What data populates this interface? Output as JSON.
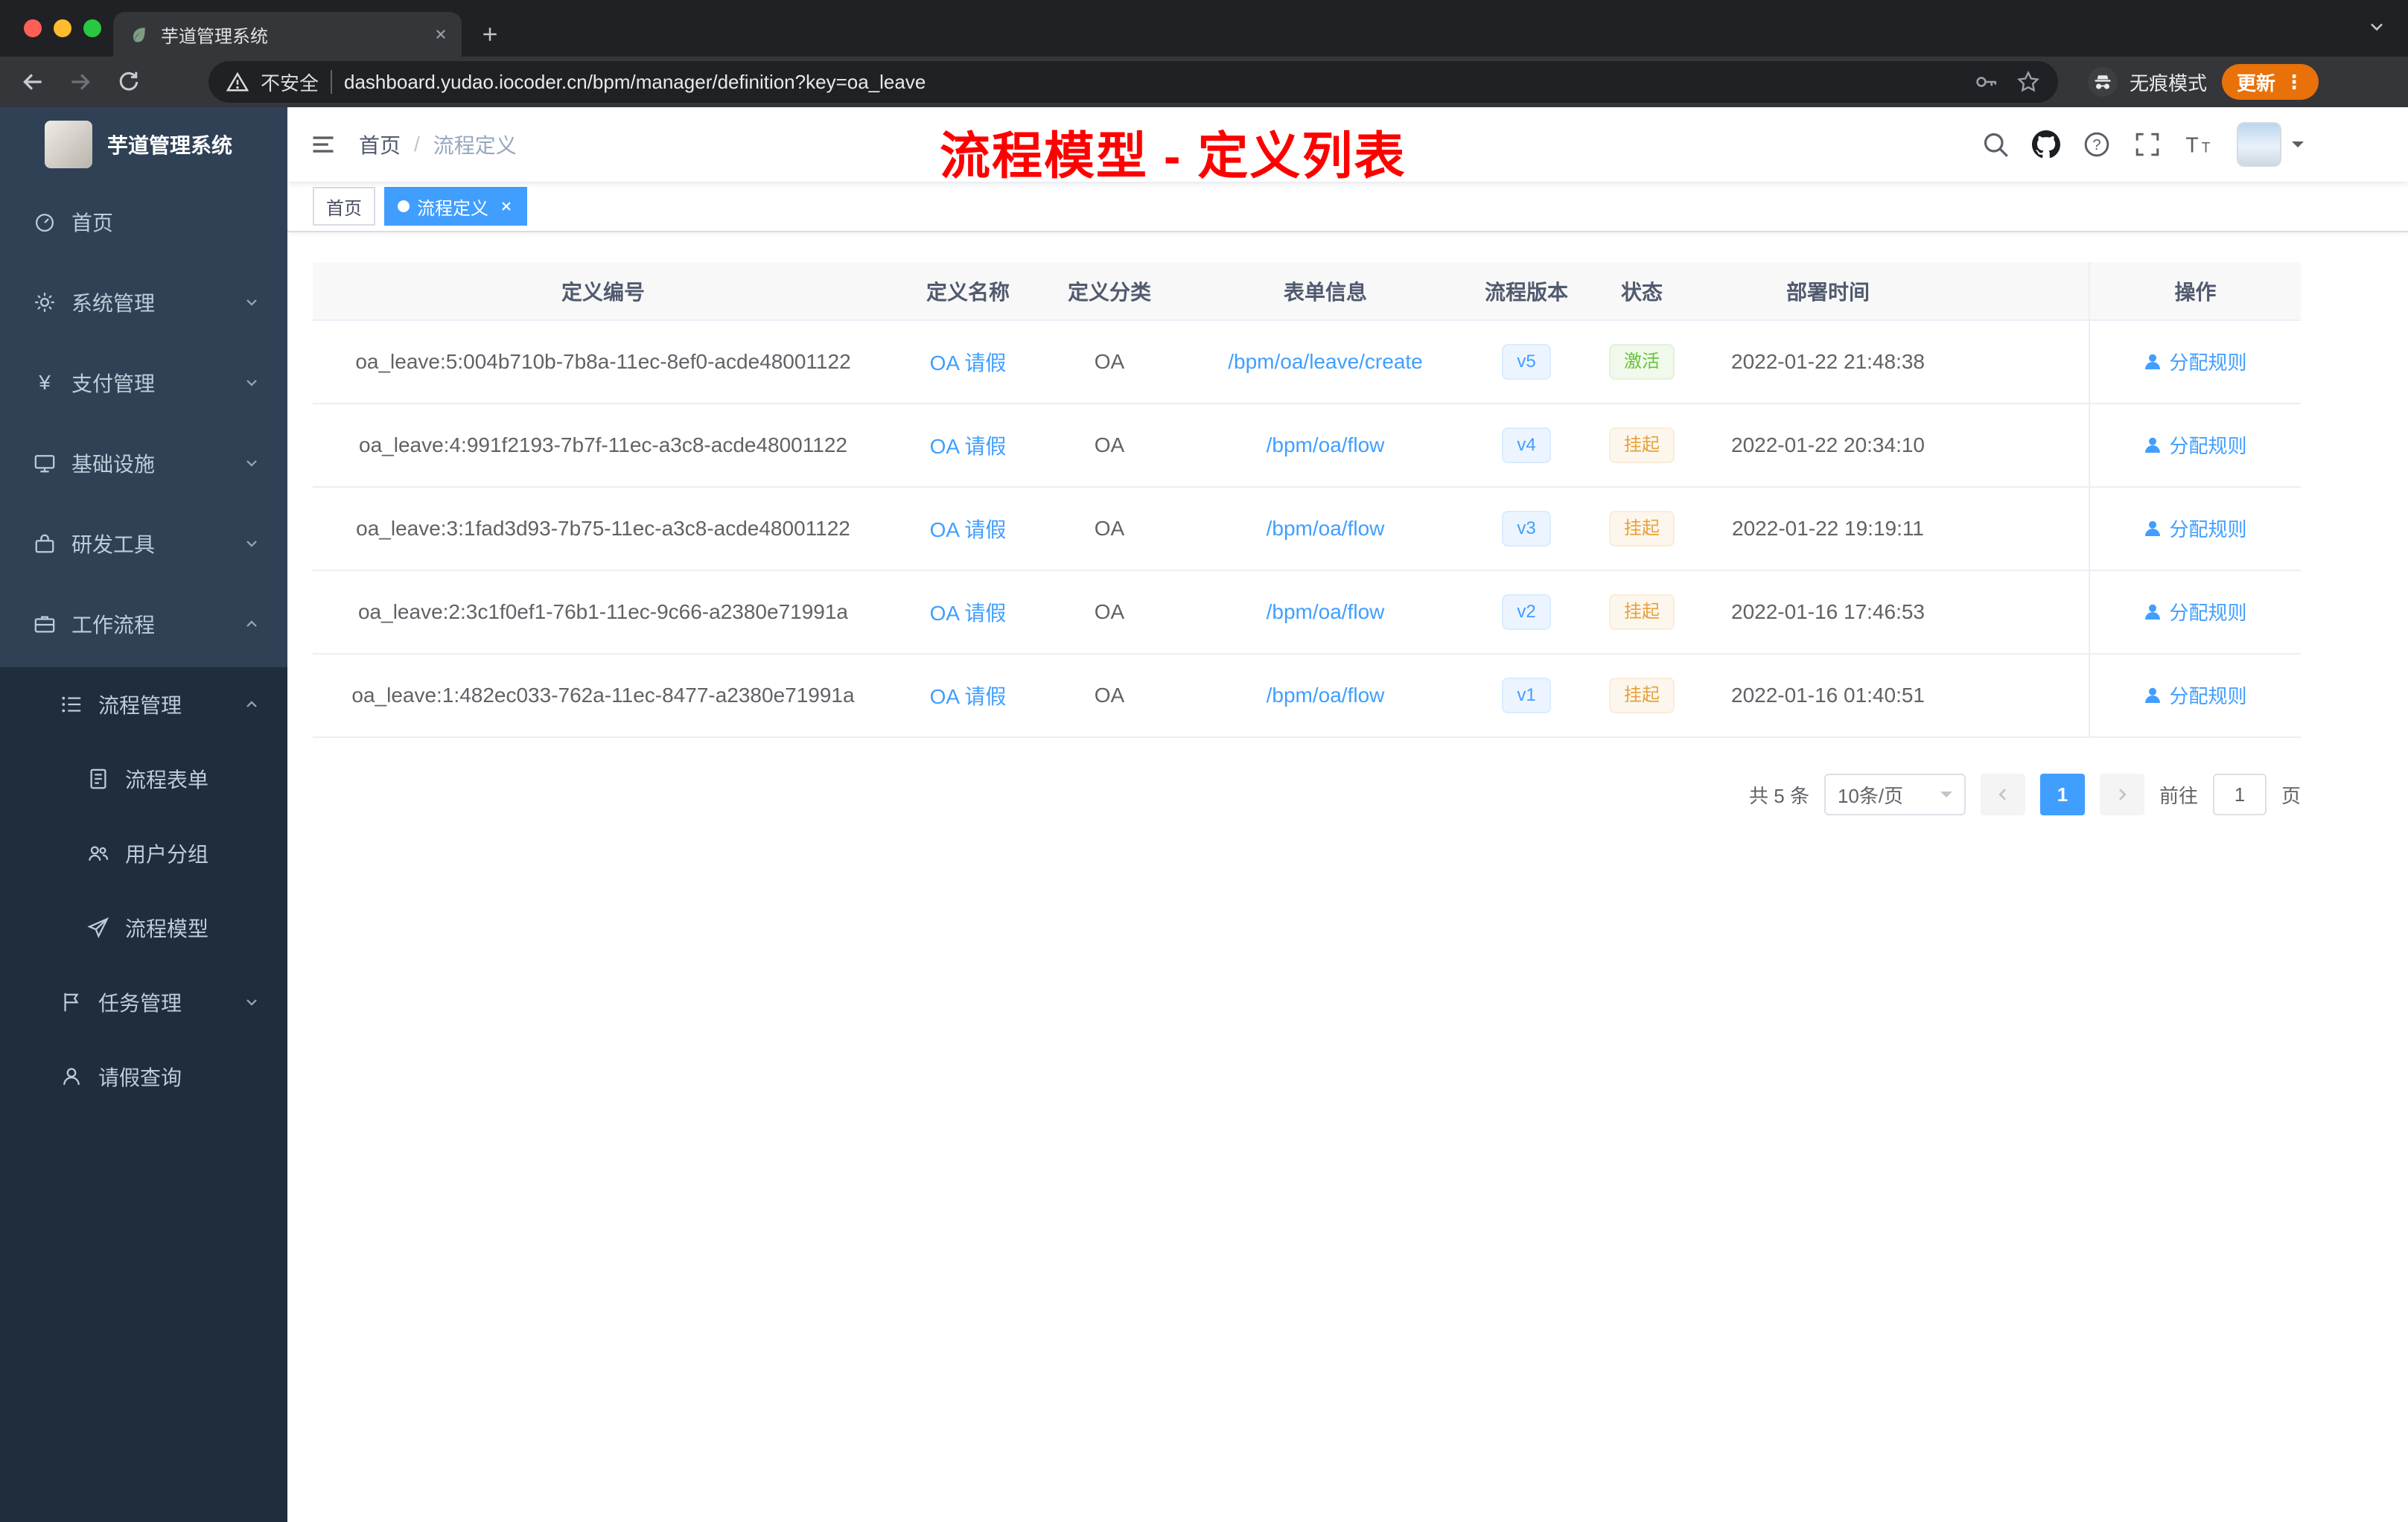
{
  "browser": {
    "tab_title": "芋道管理系统",
    "security_label": "不安全",
    "url": "dashboard.yudao.iocoder.cn/bpm/manager/definition?key=oa_leave",
    "incognito_label": "无痕模式",
    "update_label": "更新",
    "menu_dots": "⋮"
  },
  "sidebar": {
    "logo_title": "芋道管理系统",
    "menu": [
      {
        "label": "首页"
      },
      {
        "label": "系统管理"
      },
      {
        "label": "支付管理"
      },
      {
        "label": "基础设施"
      },
      {
        "label": "研发工具"
      },
      {
        "label": "工作流程"
      },
      {
        "label": "流程管理"
      },
      {
        "label": "流程表单"
      },
      {
        "label": "用户分组"
      },
      {
        "label": "流程模型"
      },
      {
        "label": "任务管理"
      },
      {
        "label": "请假查询"
      }
    ]
  },
  "header": {
    "breadcrumb_home": "首页",
    "breadcrumb_sep": "/",
    "breadcrumb_current": "流程定义",
    "annotation": "流程模型 - 定义列表"
  },
  "tags": {
    "home": "首页",
    "active": "流程定义"
  },
  "table": {
    "columns": [
      "定义编号",
      "定义名称",
      "定义分类",
      "表单信息",
      "流程版本",
      "状态",
      "部署时间",
      "操作"
    ],
    "rows": [
      {
        "id": "oa_leave:5:004b710b-7b8a-11ec-8ef0-acde48001122",
        "name": "OA 请假",
        "category": "OA",
        "form": "/bpm/oa/leave/create",
        "version": "v5",
        "status": "激活",
        "status_type": "success",
        "time": "2022-01-22 21:48:38",
        "action": "分配规则"
      },
      {
        "id": "oa_leave:4:991f2193-7b7f-11ec-a3c8-acde48001122",
        "name": "OA 请假",
        "category": "OA",
        "form": "/bpm/oa/flow",
        "version": "v4",
        "status": "挂起",
        "status_type": "warning",
        "time": "2022-01-22 20:34:10",
        "action": "分配规则"
      },
      {
        "id": "oa_leave:3:1fad3d93-7b75-11ec-a3c8-acde48001122",
        "name": "OA 请假",
        "category": "OA",
        "form": "/bpm/oa/flow",
        "version": "v3",
        "status": "挂起",
        "status_type": "warning",
        "time": "2022-01-22 19:19:11",
        "action": "分配规则"
      },
      {
        "id": "oa_leave:2:3c1f0ef1-76b1-11ec-9c66-a2380e71991a",
        "name": "OA 请假",
        "category": "OA",
        "form": "/bpm/oa/flow",
        "version": "v2",
        "status": "挂起",
        "status_type": "warning",
        "time": "2022-01-16 17:46:53",
        "action": "分配规则"
      },
      {
        "id": "oa_leave:1:482ec033-762a-11ec-8477-a2380e71991a",
        "name": "OA 请假",
        "category": "OA",
        "form": "/bpm/oa/flow",
        "version": "v1",
        "status": "挂起",
        "status_type": "warning",
        "time": "2022-01-16 01:40:51",
        "action": "分配规则"
      }
    ]
  },
  "pagination": {
    "total": "共 5 条",
    "page_size": "10条/页",
    "page": "1",
    "goto_prefix": "前往",
    "goto_value": "1",
    "goto_suffix": "页"
  },
  "colors": {
    "accent": "#409eff",
    "annotation_red": "#fe0000",
    "sidebar_bg": "#304156",
    "submenu_bg": "#1f2d3d",
    "success": "#67c23a",
    "warning": "#e6a23c"
  }
}
